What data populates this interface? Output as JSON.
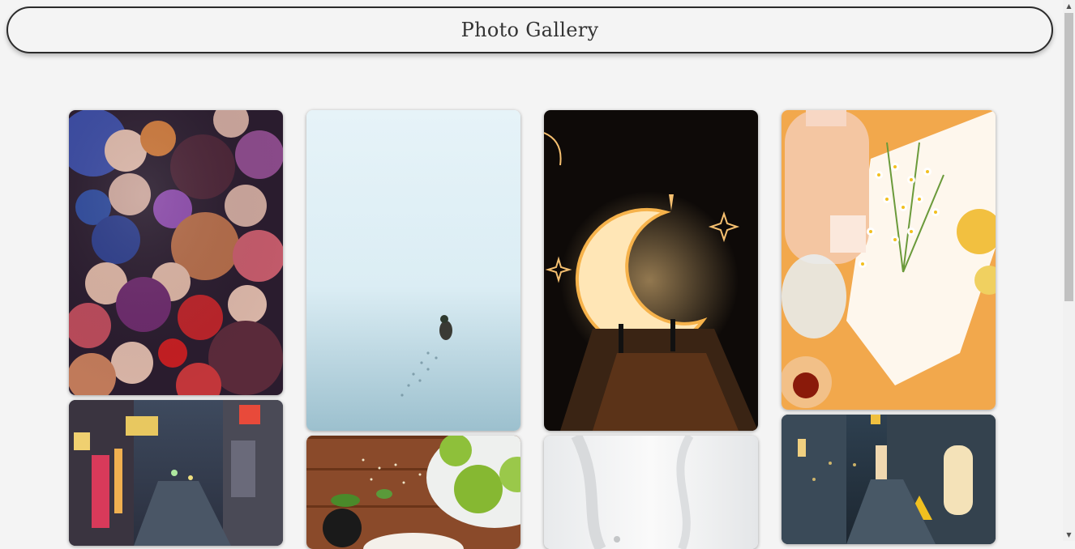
{
  "header": {
    "title": "Photo Gallery"
  },
  "gallery": {
    "photos": [
      {
        "subject": "christmas-ornaments"
      },
      {
        "subject": "duck-in-snow"
      },
      {
        "subject": "crescent-moon-lights"
      },
      {
        "subject": "drink-and-chamomile"
      },
      {
        "subject": "neon-alley"
      },
      {
        "subject": "green-apples-on-wood"
      },
      {
        "subject": "white-fabric"
      },
      {
        "subject": "rainy-street-lanterns"
      }
    ]
  }
}
